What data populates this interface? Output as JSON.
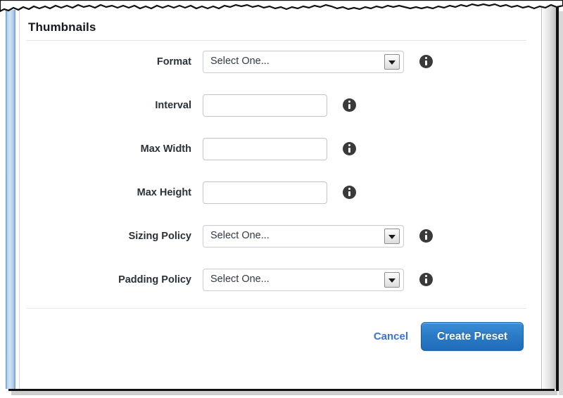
{
  "panel": {
    "section_title": "Thumbnails",
    "select_placeholder": "Select One...",
    "info_icon_name": "info-icon"
  },
  "fields": [
    {
      "label": "Format",
      "type": "select",
      "value": "Select One...",
      "input_value": ""
    },
    {
      "label": "Interval",
      "type": "text",
      "value": "",
      "input_value": ""
    },
    {
      "label": "Max Width",
      "type": "text",
      "value": "",
      "input_value": ""
    },
    {
      "label": "Max Height",
      "type": "text",
      "value": "",
      "input_value": ""
    },
    {
      "label": "Sizing Policy",
      "type": "select",
      "value": "Select One...",
      "input_value": ""
    },
    {
      "label": "Padding Policy",
      "type": "select",
      "value": "Select One...",
      "input_value": ""
    }
  ],
  "footer": {
    "cancel_label": "Cancel",
    "submit_label": "Create Preset"
  },
  "colors": {
    "primary_button": "#2b7bc6",
    "link": "#3b73d4",
    "label_text": "#2b3138",
    "info_icon": "#3a3a3a",
    "left_stripe": "#a9c9e9",
    "border": "#c9cdd1"
  }
}
